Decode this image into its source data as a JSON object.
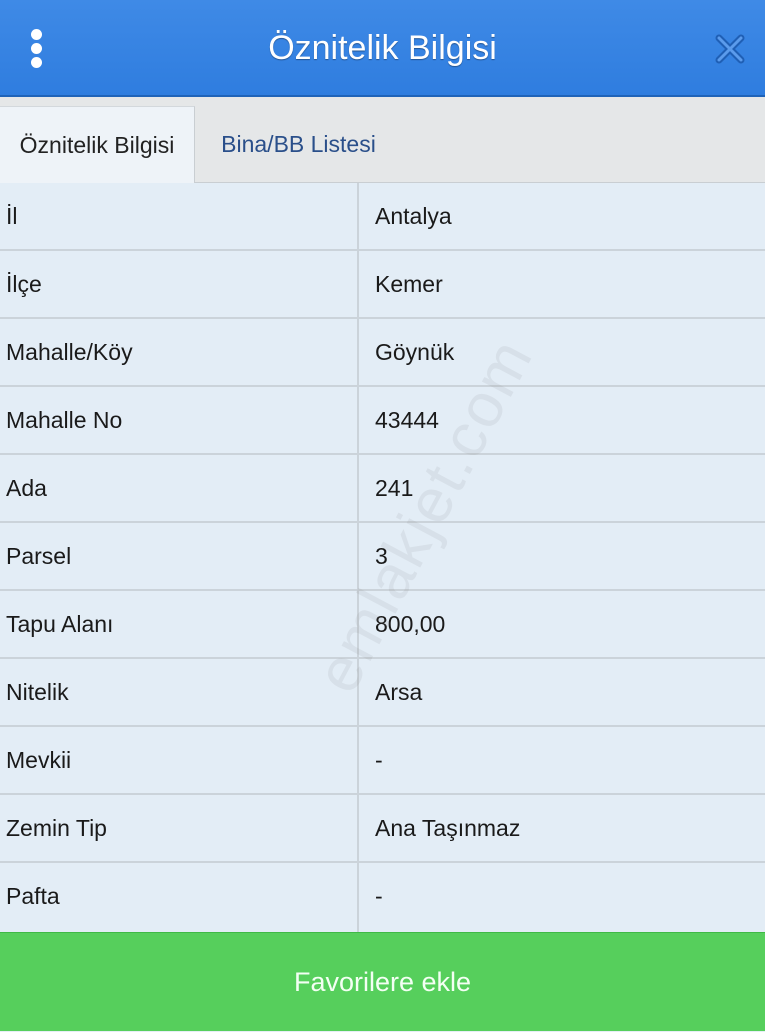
{
  "header": {
    "title": "Öznitelik Bilgisi",
    "menu_icon": "vertical-ellipsis-icon",
    "close_icon": "close-icon"
  },
  "tabs": [
    {
      "label": "Öznitelik Bilgisi",
      "active": true
    },
    {
      "label": "Bina/BB Listesi",
      "active": false
    }
  ],
  "rows": [
    {
      "label": "İl",
      "value": "Antalya"
    },
    {
      "label": "İlçe",
      "value": "Kemer"
    },
    {
      "label": "Mahalle/Köy",
      "value": "Göynük"
    },
    {
      "label": "Mahalle No",
      "value": "43444"
    },
    {
      "label": "Ada",
      "value": "241"
    },
    {
      "label": "Parsel",
      "value": "3"
    },
    {
      "label": "Tapu Alanı",
      "value": "800,00"
    },
    {
      "label": "Nitelik",
      "value": "Arsa"
    },
    {
      "label": "Mevkii",
      "value": "-"
    },
    {
      "label": "Zemin Tip",
      "value": "Ana Taşınmaz"
    },
    {
      "label": "Pafta",
      "value": "-"
    }
  ],
  "watermark": "emlakjet.com",
  "footer": {
    "favorite_label": "Favorilere ekle"
  },
  "colors": {
    "header_bg": "#3584e4",
    "button_bg": "#56cf5c",
    "table_bg": "#e3edf6"
  }
}
